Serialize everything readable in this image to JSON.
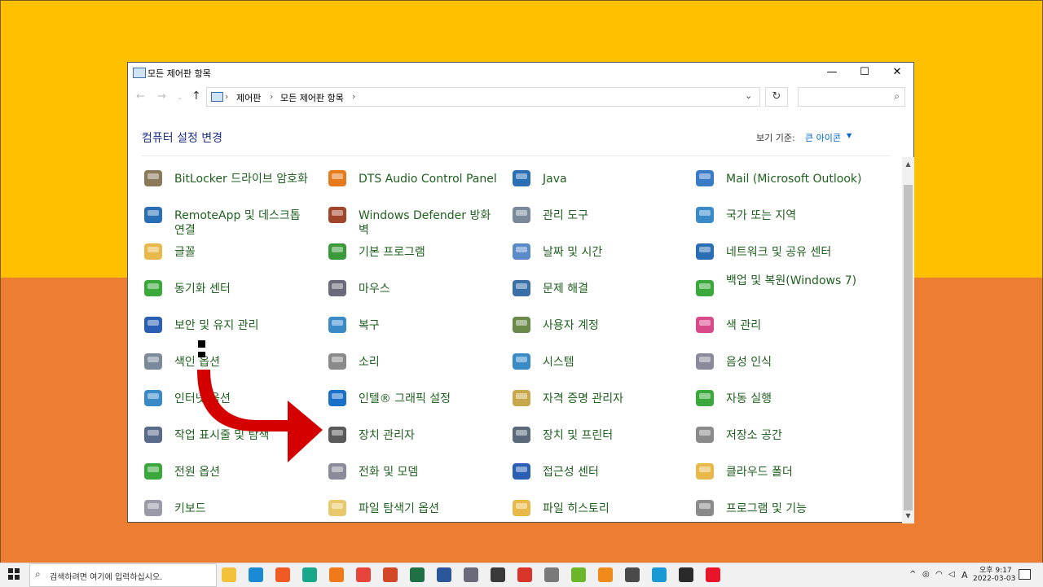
{
  "window": {
    "title": "모든 제어판 항목",
    "controls": {
      "minimize": "—",
      "maximize": "☐",
      "close": "✕"
    }
  },
  "nav": {
    "back": "←",
    "forward": "→",
    "up": "↑",
    "breadcrumb": [
      "제어판",
      "모든 제어판 항목"
    ],
    "separator": "›",
    "refresh": "↻",
    "search_placeholder": ""
  },
  "header": {
    "title": "컴퓨터 설정 변경",
    "view_by_label": "보기 기준:",
    "view_by_value": "큰 아이콘"
  },
  "items": [
    {
      "label": "BitLocker 드라이브 암호화",
      "icon": "bitlocker-icon",
      "color": "#8a7a5a"
    },
    {
      "label": "DTS Audio Control Panel",
      "icon": "dts-audio-icon",
      "color": "#e87a1e"
    },
    {
      "label": "Java",
      "icon": "java-icon",
      "color": "#2a6fb5"
    },
    {
      "label": "Mail (Microsoft Outlook)",
      "icon": "mail-icon",
      "color": "#3a7bc8"
    },
    {
      "label": "RemoteApp 및 데스크톱 연결",
      "icon": "remoteapp-icon",
      "color": "#2a6fb5"
    },
    {
      "label": "Windows Defender 방화벽",
      "icon": "firewall-icon",
      "color": "#a0442a"
    },
    {
      "label": "관리 도구",
      "icon": "admin-tools-icon",
      "color": "#7a8a9a"
    },
    {
      "label": "국가 또는 지역",
      "icon": "region-icon",
      "color": "#3a8ac8"
    },
    {
      "label": "글꼴",
      "icon": "fonts-icon",
      "color": "#e8b84a"
    },
    {
      "label": "기본 프로그램",
      "icon": "default-programs-icon",
      "color": "#3a9a3a"
    },
    {
      "label": "날짜 및 시간",
      "icon": "date-time-icon",
      "color": "#5a8ac8"
    },
    {
      "label": "네트워크 및 공유 센터",
      "icon": "network-icon",
      "color": "#2a6fb5"
    },
    {
      "label": "동기화 센터",
      "icon": "sync-center-icon",
      "color": "#3aa83a"
    },
    {
      "label": "마우스",
      "icon": "mouse-icon",
      "color": "#6a6a7a"
    },
    {
      "label": "문제 해결",
      "icon": "troubleshooting-icon",
      "color": "#3a6fa8"
    },
    {
      "label": "백업 및 복원(Windows 7)",
      "icon": "backup-icon",
      "color": "#3aa83a"
    },
    {
      "label": "보안 및 유지 관리",
      "icon": "security-flag-icon",
      "color": "#2a5fb5"
    },
    {
      "label": "복구",
      "icon": "recovery-icon",
      "color": "#3a8ac8"
    },
    {
      "label": "사용자 계정",
      "icon": "user-accounts-icon",
      "color": "#6a8a4a"
    },
    {
      "label": "색 관리",
      "icon": "color-management-icon",
      "color": "#d84a8a"
    },
    {
      "label": "색인 옵션",
      "icon": "indexing-icon",
      "color": "#7a8a9a"
    },
    {
      "label": "소리",
      "icon": "sound-icon",
      "color": "#8a8a8a"
    },
    {
      "label": "시스템",
      "icon": "system-icon",
      "color": "#3a8ac8"
    },
    {
      "label": "음성 인식",
      "icon": "speech-icon",
      "color": "#8a8a9a"
    },
    {
      "label": "인터넷 옵션",
      "icon": "internet-options-icon",
      "color": "#3a8ac8"
    },
    {
      "label": "인텔® 그래픽 설정",
      "icon": "intel-graphics-icon",
      "color": "#1a6fc8"
    },
    {
      "label": "자격 증명 관리자",
      "icon": "credential-icon",
      "color": "#c8a84a"
    },
    {
      "label": "자동 실행",
      "icon": "autoplay-icon",
      "color": "#3aa83a"
    },
    {
      "label": "작업 표시줄 및 탐색",
      "icon": "taskbar-icon",
      "color": "#5a6a8a"
    },
    {
      "label": "장치 관리자",
      "icon": "device-manager-icon",
      "color": "#5a5a5a"
    },
    {
      "label": "장치 및 프린터",
      "icon": "devices-printers-icon",
      "color": "#5a6a7a"
    },
    {
      "label": "저장소 공간",
      "icon": "storage-spaces-icon",
      "color": "#8a8a8a"
    },
    {
      "label": "전원 옵션",
      "icon": "power-options-icon",
      "color": "#3aa83a"
    },
    {
      "label": "전화 및 모뎀",
      "icon": "phone-modem-icon",
      "color": "#8a8a9a"
    },
    {
      "label": "접근성 센터",
      "icon": "ease-of-access-icon",
      "color": "#2a5fb5"
    },
    {
      "label": "클라우드 폴더",
      "icon": "cloud-folder-icon",
      "color": "#e8b84a"
    },
    {
      "label": "키보드",
      "icon": "keyboard-icon",
      "color": "#9a9aa8"
    },
    {
      "label": "파일 탐색기 옵션",
      "icon": "folder-options-icon",
      "color": "#e8c86a"
    },
    {
      "label": "파일 히스토리",
      "icon": "file-history-icon",
      "color": "#e8b84a"
    },
    {
      "label": "프로그램 및 기능",
      "icon": "programs-features-icon",
      "color": "#8a8a8a"
    }
  ],
  "taskbar": {
    "search_placeholder": "검색하려면 여기에 입력하십시오.",
    "apps": [
      {
        "icon": "file-explorer-icon",
        "color": "#f3c13a"
      },
      {
        "icon": "edge-icon",
        "color": "#1a8ad4"
      },
      {
        "icon": "brave-icon",
        "color": "#f05a24"
      },
      {
        "icon": "app-green-icon",
        "color": "#1aa88a"
      },
      {
        "icon": "firefox-icon",
        "color": "#f07a1a"
      },
      {
        "icon": "chrome-icon",
        "color": "#e8453a"
      },
      {
        "icon": "powerpoint-icon",
        "color": "#d24726"
      },
      {
        "icon": "excel-icon",
        "color": "#1e7145"
      },
      {
        "icon": "word-icon",
        "color": "#2b579a"
      },
      {
        "icon": "photos-icon",
        "color": "#6a6a7a"
      },
      {
        "icon": "search-tool-icon",
        "color": "#3a3a3a"
      },
      {
        "icon": "app-red-icon",
        "color": "#d8342a"
      },
      {
        "icon": "app-gray-icon",
        "color": "#7a7a7a"
      },
      {
        "icon": "app-lime-icon",
        "color": "#6ab82a"
      },
      {
        "icon": "vlc-icon",
        "color": "#f08a1a"
      },
      {
        "icon": "calculator-icon",
        "color": "#4a4a4a"
      },
      {
        "icon": "chrome-alt-icon",
        "color": "#1a9ad4"
      },
      {
        "icon": "notes-icon",
        "color": "#2a2a2a"
      },
      {
        "icon": "opera-icon",
        "color": "#e8142a"
      }
    ],
    "tray": {
      "chevron": "^",
      "ime": "A"
    },
    "clock_time": "오후 9:17",
    "clock_date": "2022-03-03"
  }
}
